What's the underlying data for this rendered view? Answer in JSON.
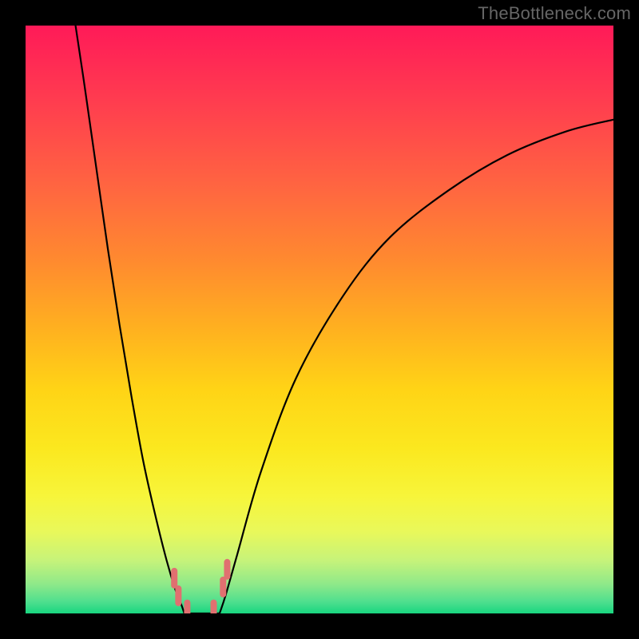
{
  "watermark": "TheBottleneck.com",
  "colors": {
    "frame": "#000000",
    "curve": "#000000",
    "marker": "#e07070",
    "gradient_top": "#ff1a58",
    "gradient_bottom": "#18d680"
  },
  "chart_data": {
    "type": "line",
    "title": "",
    "xlabel": "",
    "ylabel": "",
    "xlim": [
      0,
      100
    ],
    "ylim": [
      0,
      100
    ],
    "grid": false,
    "notes": "Curve resembling a bottleneck V-shape on a red-to-green vertical gradient. No numeric axis ticks are visible in the image; values below are estimated from pixel positions (0-100 range on each axis).",
    "series": [
      {
        "name": "left-branch",
        "x": [
          8.5,
          10,
          12,
          14,
          16,
          18,
          20,
          22,
          24,
          25.5,
          26.5,
          27
        ],
        "y": [
          100,
          90,
          76,
          62,
          49,
          37,
          26,
          17,
          9,
          4,
          1.5,
          0
        ]
      },
      {
        "name": "right-branch",
        "x": [
          33,
          34,
          36,
          40,
          46,
          54,
          62,
          72,
          82,
          92,
          100
        ],
        "y": [
          0,
          3,
          10,
          24,
          40,
          54,
          64,
          72,
          78,
          82,
          84
        ]
      },
      {
        "name": "floor",
        "x": [
          27,
          33
        ],
        "y": [
          0,
          0
        ]
      }
    ],
    "markers": {
      "description": "Short salmon tick marks near the curve floor",
      "points": [
        {
          "x": 25.3,
          "y": 6.0
        },
        {
          "x": 26.0,
          "y": 3.0
        },
        {
          "x": 27.5,
          "y": 0.6
        },
        {
          "x": 32.0,
          "y": 0.6
        },
        {
          "x": 33.6,
          "y": 4.5
        },
        {
          "x": 34.3,
          "y": 7.5
        }
      ]
    }
  }
}
